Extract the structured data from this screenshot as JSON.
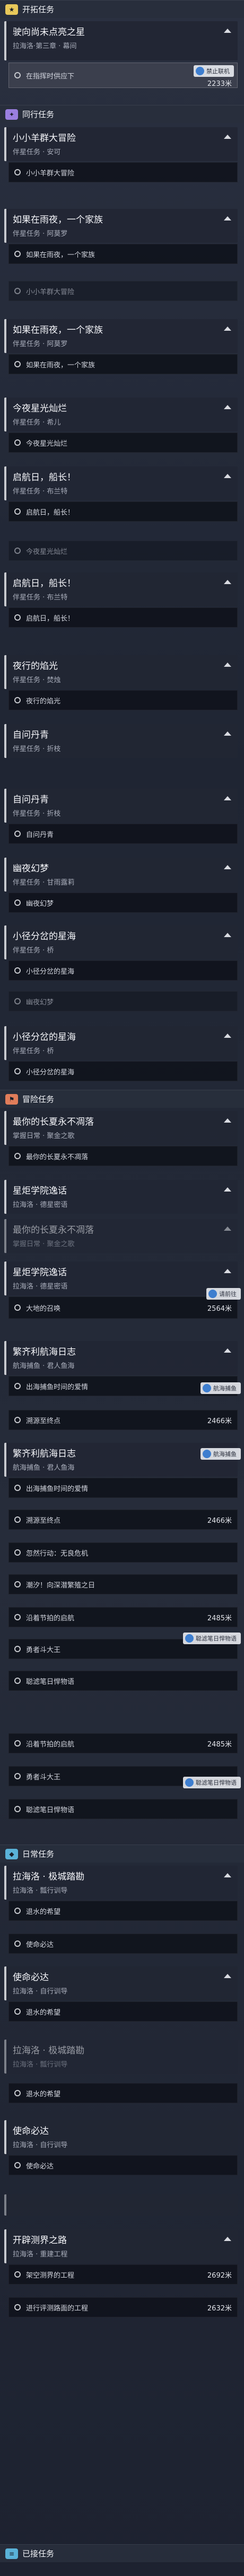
{
  "sections": {
    "trailblaze": {
      "label": "开拓任务",
      "color": "#e8c85a"
    },
    "companion": {
      "label": "同行任务",
      "color": "#9a7fe0"
    },
    "adventure": {
      "label": "冒险任务",
      "color": "#e07d5a"
    },
    "daily": {
      "label": "日常任务",
      "color": "#5ab2d8"
    },
    "bottom": {
      "label": "已接任务",
      "color": "#5ab2d8"
    }
  },
  "quests": [
    {
      "title": "驶向尚未点亮之星",
      "sub": "拉海洛·第三章 · 幕间",
      "open": true
    },
    {
      "title": "小小羊群大冒险",
      "sub": "伴星任务 · 安可",
      "open": true
    },
    {
      "title": "如果在雨夜，一个家族",
      "sub": "伴星任务 · 阿莫罗",
      "open": true
    },
    {
      "title": "今夜星光灿烂",
      "sub": "伴星任务 · 希儿",
      "open": true
    },
    {
      "title": "启航日，船长！",
      "sub": "伴星任务 · 布兰特",
      "open": true
    },
    {
      "title": "夜行的焰光",
      "sub": "伴星任务 · 焚烛",
      "open": true
    },
    {
      "title": "自问丹青",
      "sub": "伴星任务 · 折枝",
      "open": true
    },
    {
      "title": "幽夜幻梦",
      "sub": "伴星任务 · 甘雨露莉",
      "open": true
    },
    {
      "title": "小径分岔的星海",
      "sub": "伴星任务 · 桥",
      "open": true
    },
    {
      "title": "最你的长夏永不凋落",
      "sub": "掌握日常 · 聚金之歌",
      "open": true
    },
    {
      "title": "星炬学院逸话",
      "sub": "拉海洛 · 德星密语",
      "open": true
    },
    {
      "title": "繁齐利航海日志",
      "sub": "航海捕鱼 · 君人鱼海",
      "open": true
    },
    {
      "title": "拉海洛 · 极城踏勘",
      "sub": "拉海洛 · 瓢行训导",
      "open": true
    },
    {
      "title": "使命必达",
      "sub": "拉海洛 · 自行训导",
      "open": true
    },
    {
      "title": "开辟测界之路",
      "sub": "拉海洛 · 重建工程",
      "open": true
    }
  ],
  "steps": [
    {
      "text": "在指挥时供应下",
      "dist": "",
      "badge": "禁止联机",
      "extra": "2233米"
    },
    {
      "text": "小小羊群大冒险",
      "dist": ""
    },
    {
      "text": "如果在雨夜，一个家族",
      "dist": ""
    },
    {
      "text": "小小羊群大冒险",
      "dist": ""
    },
    {
      "text": "如果在雨夜，一个家族",
      "dist": ""
    },
    {
      "text": "今夜星光灿烂",
      "dist": ""
    },
    {
      "text": "启航日，船长！",
      "dist": ""
    },
    {
      "text": "今夜星光灿烂",
      "dist": ""
    },
    {
      "text": "夜行的焰光",
      "dist": ""
    },
    {
      "text": "自问丹青",
      "dist": ""
    },
    {
      "text": "幽夜幻梦",
      "dist": ""
    },
    {
      "text": "幽夜幻梦",
      "dist": ""
    },
    {
      "text": "小径分岔的星海",
      "dist": ""
    },
    {
      "text": "最你的长夏永不凋落",
      "dist": ""
    },
    {
      "text": "大地的召唤",
      "dist": "2564米"
    },
    {
      "text": "出海捕鱼时间的爱情",
      "dist": ""
    },
    {
      "text": "溯源至终点",
      "dist": "2466米"
    },
    {
      "text": "出海捕鱼时间的爱情",
      "dist": ""
    },
    {
      "text": "溯源至终点",
      "dist": "2466米"
    },
    {
      "text": "忽然行动：无良危机",
      "dist": ""
    },
    {
      "text": "潮汐！向深潜繁殖之日",
      "dist": ""
    },
    {
      "text": "沿着节拍的启航",
      "dist": "2485米"
    },
    {
      "text": "勇者斗大王",
      "dist": ""
    },
    {
      "text": "聪滤笔日悍物语",
      "dist": ""
    },
    {
      "text": "沿着节拍的启航",
      "dist": "2485米"
    },
    {
      "text": "勇者斗大王",
      "dist": ""
    },
    {
      "text": "聪滤笔日悍物语",
      "dist": ""
    },
    {
      "text": "退水的希望",
      "dist": ""
    },
    {
      "text": "使命必达",
      "dist": ""
    },
    {
      "text": "退水的希望",
      "dist": ""
    },
    {
      "text": "使命必达",
      "dist": ""
    },
    {
      "text": "架空测界的工程",
      "dist": "2692米"
    },
    {
      "text": "进行评测路面的工程",
      "dist": "2632米"
    }
  ],
  "badges": {
    "danger": "禁止联机",
    "hint1": "请前往",
    "hint2": "烁影之海",
    "boat": "航海捕鱼",
    "guide": "聪滤笔日悍物语"
  }
}
